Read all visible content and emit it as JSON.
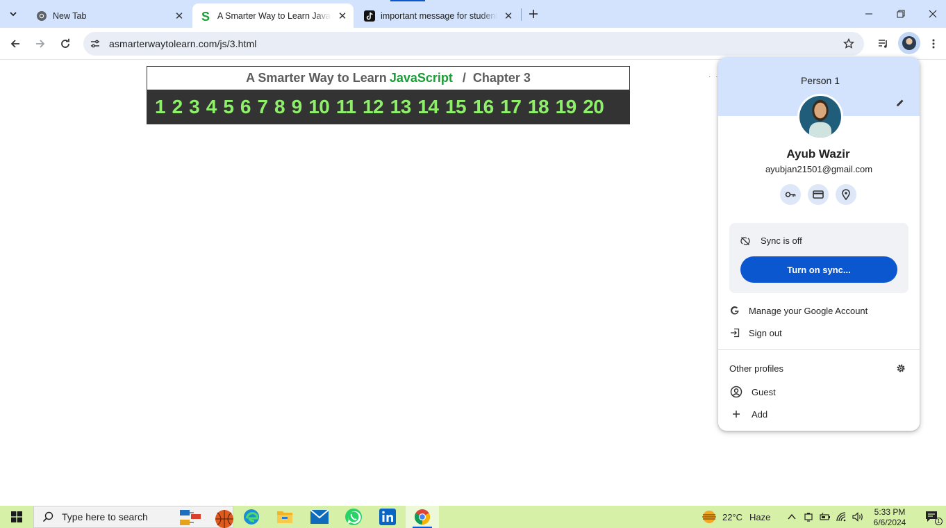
{
  "browser": {
    "tabs": [
      {
        "title": "New Tab",
        "icon": "chrome-icon",
        "active": false
      },
      {
        "title": "A Smarter Way to Learn JavaScript",
        "icon": "site-s-icon",
        "active": true
      },
      {
        "title": "important message for students",
        "icon": "tiktok-icon",
        "active": false
      }
    ],
    "url": "asmarterwaytolearn.com/js/3.html",
    "accent": "#0b57d0",
    "tabstrip_color": "#d3e3fd"
  },
  "page": {
    "title_prefix": "A Smarter Way to Learn",
    "title_highlight": "JavaScript",
    "title_separator": "/",
    "title_chapter": "Chapter 3",
    "chapters": [
      "1",
      "2",
      "3",
      "4",
      "5",
      "6",
      "7",
      "8",
      "9",
      "10",
      "11",
      "12",
      "13",
      "14",
      "15",
      "16",
      "17",
      "18",
      "19",
      "20"
    ],
    "dots": "· · ·",
    "chapter_color": "#8ef06a",
    "highlight_color": "#1a9d36"
  },
  "profile_menu": {
    "header": "Person 1",
    "name": "Ayub Wazir",
    "email": "ayubjan21501@gmail.com",
    "quick_icons": [
      "key-icon",
      "card-icon",
      "location-icon"
    ],
    "sync_status": "Sync is off",
    "sync_button": "Turn on sync...",
    "manage_account": "Manage your Google Account",
    "sign_out": "Sign out",
    "other_profiles_title": "Other profiles",
    "guest": "Guest",
    "add": "Add"
  },
  "taskbar": {
    "search_placeholder": "Type here to search",
    "weather_temp": "22°C",
    "weather_condition": "Haze",
    "time": "5:33 PM",
    "date": "6/6/2024",
    "notification_count": "1",
    "color": "#d6f0a8"
  }
}
